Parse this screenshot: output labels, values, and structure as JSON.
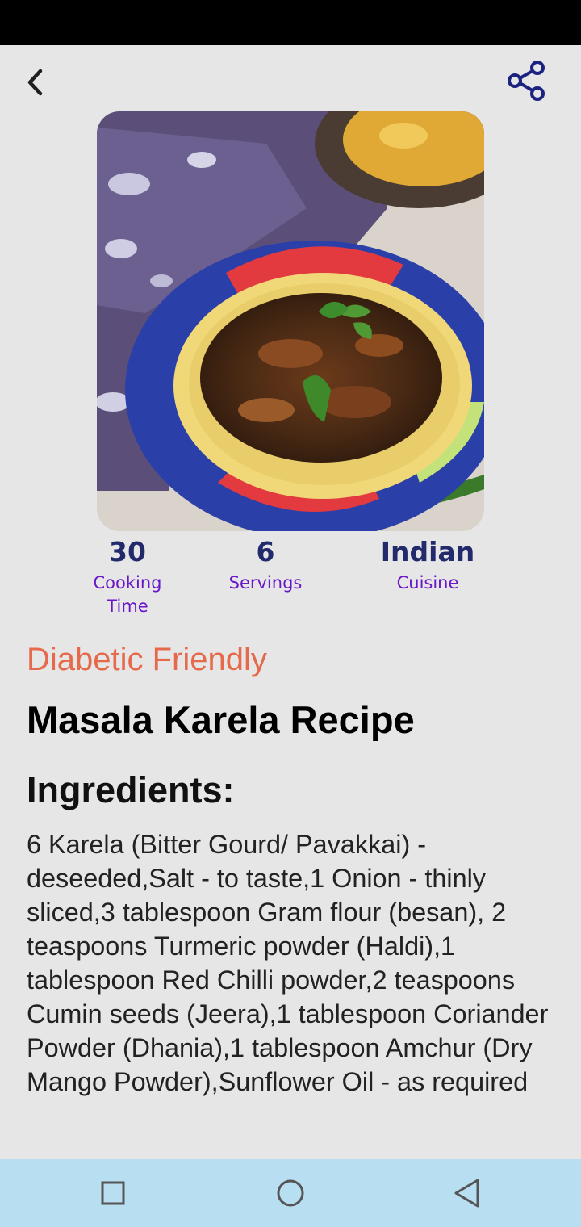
{
  "app": {
    "back_icon": "chevron-left-icon",
    "share_icon": "share-icon",
    "accent_color": "#232a6b",
    "label_color": "#6a17c9",
    "tag_color": "#e5694a"
  },
  "recipe": {
    "image": "photo of masala karela (bitter gourd stir fry) in a colorful plate",
    "stats": [
      {
        "value": "30",
        "label": "Cooking Time"
      },
      {
        "value": "6",
        "label": "Servings"
      },
      {
        "value": "Indian",
        "label": "Cuisine"
      }
    ],
    "tag": "Diabetic Friendly",
    "title": "Masala Karela Recipe",
    "ingredients_heading": "Ingredients:",
    "ingredients": "6 Karela (Bitter Gourd/ Pavakkai) - deseeded,Salt - to taste,1 Onion - thinly sliced,3 tablespoon Gram flour (besan), 2 teaspoons Turmeric powder (Haldi),1 tablespoon Red Chilli powder,2 teaspoons Cumin seeds (Jeera),1 tablespoon Coriander Powder (Dhania),1 tablespoon Amchur (Dry Mango Powder),Sunflower Oil - as required"
  },
  "nav": {
    "recents_icon": "square-icon",
    "home_icon": "circle-icon",
    "back_icon": "triangle-back-icon"
  }
}
